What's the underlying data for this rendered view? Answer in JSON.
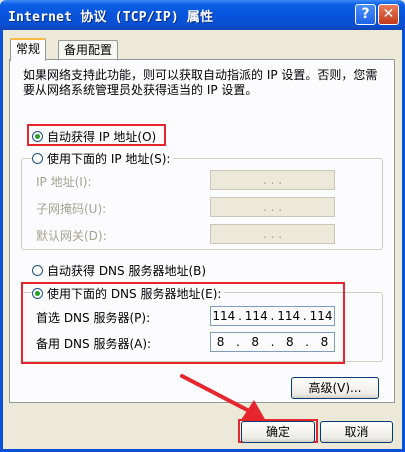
{
  "window": {
    "title": "Internet 协议 (TCP/IP) 属性"
  },
  "titlebar": {
    "help_label": "?",
    "close_label": "✕"
  },
  "tabs": [
    {
      "label": "常规"
    },
    {
      "label": "备用配置"
    }
  ],
  "description": "如果网络支持此功能，则可以获取自动指派的 IP 设置。否则，您需要从网络系统管理员处获得适当的 IP 设置。",
  "ip": {
    "auto_label": "自动获得 IP 地址(O)",
    "manual_label": "使用下面的 IP 地址(S):",
    "fields": [
      {
        "label": "IP 地址(I):",
        "value": "  .  .  ."
      },
      {
        "label": "子网掩码(U):",
        "value": "  .  .  ."
      },
      {
        "label": "默认网关(D):",
        "value": "  .  .  ."
      }
    ]
  },
  "dns": {
    "auto_label": "自动获得 DNS 服务器地址(B)",
    "manual_label": "使用下面的 DNS 服务器地址(E):",
    "preferred": {
      "label": "首选 DNS 服务器(P):",
      "octets": [
        "114",
        "114",
        "114",
        "114"
      ]
    },
    "alternate": {
      "label": "备用 DNS 服务器(A):",
      "octets": [
        "8",
        "8",
        "8",
        "8"
      ]
    }
  },
  "buttons": {
    "advanced": "高级(V)...",
    "ok": "确定",
    "cancel": "取消"
  },
  "colors": {
    "highlight": "#e5262c",
    "titlebar": "#0a5ee6",
    "face": "#ece9d8"
  }
}
